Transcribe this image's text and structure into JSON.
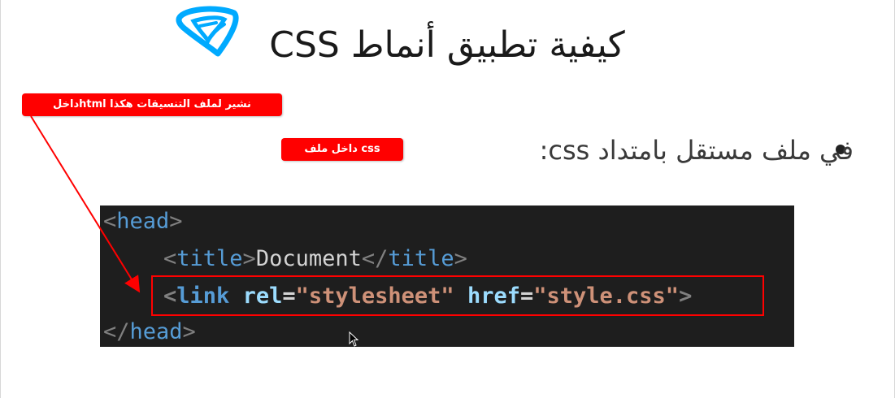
{
  "slide": {
    "title": "كيفية تطبيق أنماط CSS",
    "bullet_text": "في ملف مستقل بامتداد  css:"
  },
  "annotations": {
    "top_badge": "نشير لملف التنسيقات هكذا htmlداخل",
    "css_badge": "css داخل ملف",
    "accent_color": "#ff0000"
  },
  "code": {
    "line1": {
      "open": "<",
      "tag": "head",
      "close": ">"
    },
    "line2": {
      "open": "<",
      "tag": "title",
      "close": ">",
      "text": "Document",
      "end_open": "</",
      "end_tag": "title",
      "end_close": ">"
    },
    "line3": {
      "open": "<",
      "tag": "link",
      "space": " ",
      "attr1": "rel",
      "eq1": "=",
      "val1": "\"stylesheet\"",
      "space2": " ",
      "attr2": "href",
      "eq2": "=",
      "val2": "\"style.css\"",
      "close": ">"
    },
    "line4": {
      "open": "</",
      "tag": "head",
      "close": ">"
    }
  },
  "icons": {
    "logo": "blue-scribble-logo-icon",
    "cursor": "mouse-pointer-icon",
    "arrow": "red-arrow-icon"
  }
}
